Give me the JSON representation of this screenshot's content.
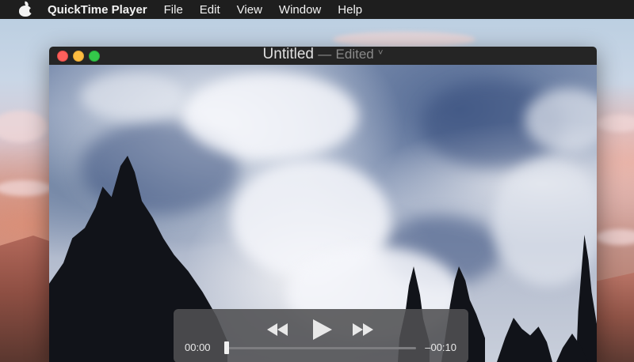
{
  "menubar": {
    "apple_icon": "apple-icon",
    "app_name": "QuickTime Player",
    "items": [
      "File",
      "Edit",
      "View",
      "Window",
      "Help"
    ]
  },
  "window": {
    "title": "Untitled",
    "separator": "—",
    "status": "Edited",
    "chevron": "˅"
  },
  "player": {
    "current_time": "00:00",
    "remaining_time": "–00:10",
    "progress": 0.0
  },
  "colors": {
    "close": "#fc605c",
    "minimize": "#fdbc40",
    "zoom": "#34c84a"
  }
}
